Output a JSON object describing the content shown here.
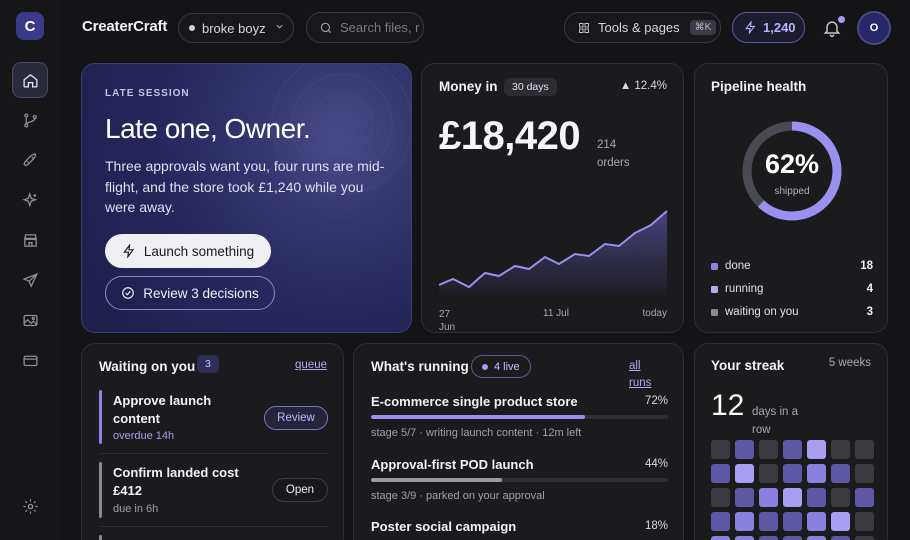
{
  "app": {
    "logo_letter": "C",
    "brand": "CreaterCraft"
  },
  "sidebar": {
    "items": [
      {
        "icon": "home-icon",
        "active": true
      },
      {
        "icon": "branch-icon"
      },
      {
        "icon": "rocket-icon"
      },
      {
        "icon": "sparkle-icon"
      },
      {
        "icon": "store-icon"
      },
      {
        "icon": "send-icon"
      },
      {
        "icon": "gallery-icon"
      },
      {
        "icon": "wallet-icon"
      }
    ],
    "settings_icon": "gear-icon"
  },
  "header": {
    "workspace": "broke boyz",
    "search_placeholder": "Search files, runs…",
    "tools_label": "Tools & pages",
    "tools_shortcut": "⌘K",
    "credits": "1,240",
    "avatar_initial": "O"
  },
  "hero": {
    "eyebrow": "LATE SESSION",
    "title": "Late one, Owner.",
    "body": "Three approvals want you, four runs are mid-flight, and the store took £1,240 while you were away.",
    "primary_label": "Launch something",
    "secondary_label": "Review 3 decisions"
  },
  "money": {
    "title": "Money in",
    "period": "30 days",
    "delta": "▲ 12.4%",
    "amount": "£18,420",
    "orders": "214 orders",
    "x_start": "27 Jun",
    "x_mid": "11 Jul",
    "x_end": "today"
  },
  "pipeline": {
    "title": "Pipeline health",
    "percent": "62%",
    "percent_value": 62,
    "sub": "shipped",
    "legend": [
      {
        "label": "done",
        "value": "18",
        "color": "#8d82e6"
      },
      {
        "label": "running",
        "value": "4",
        "color": "#b3aaf2"
      },
      {
        "label": "waiting on you",
        "value": "3",
        "color": "#8a8a94"
      }
    ]
  },
  "waiting": {
    "title": "Waiting on you",
    "count": "3",
    "link": "queue",
    "items": [
      {
        "title": "Approve launch content",
        "sub": "overdue 14h",
        "action": "Review"
      },
      {
        "title": "Confirm landed cost £412",
        "sub": "due in 6h",
        "action": "Open"
      }
    ]
  },
  "running": {
    "title": "What's running",
    "live": "4 live",
    "link": "all runs",
    "items": [
      {
        "name": "E-commerce single product store",
        "pct": "72%",
        "value": 72,
        "meta": "stage 5/7 · writing launch content · 12m left"
      },
      {
        "name": "Approval-first POD launch",
        "pct": "44%",
        "value": 44,
        "meta": "stage 3/9 · parked on your approval"
      },
      {
        "name": "Poster social campaign",
        "pct": "18%",
        "value": 18,
        "meta": ""
      }
    ]
  },
  "streak": {
    "title": "Your streak",
    "weeks": "5 weeks",
    "days": "12",
    "unit": "days in a row",
    "levels": [
      [
        0,
        1,
        0,
        1,
        3,
        0,
        0
      ],
      [
        1,
        3,
        0,
        1,
        2,
        1,
        0
      ],
      [
        0,
        1,
        2,
        3,
        1,
        0,
        1
      ],
      [
        1,
        2,
        1,
        1,
        2,
        3,
        0
      ],
      [
        2,
        2,
        1,
        1,
        2,
        1,
        0
      ]
    ]
  }
}
